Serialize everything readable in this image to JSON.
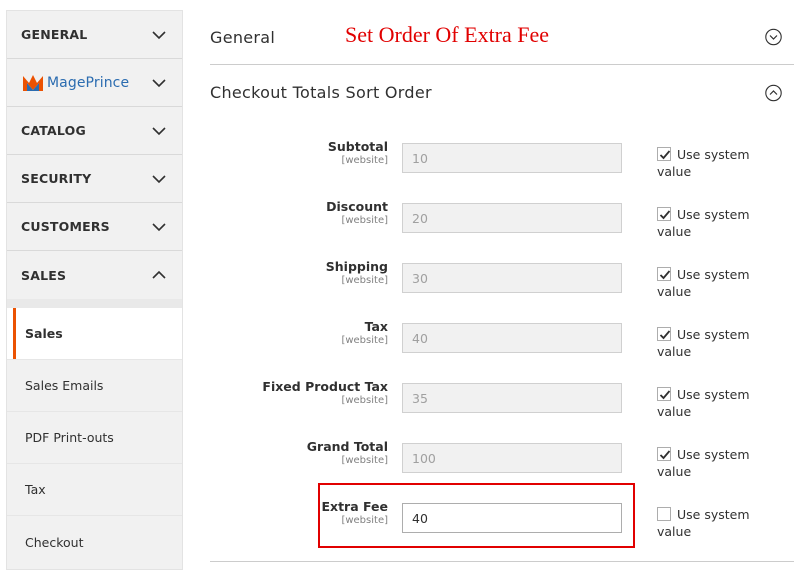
{
  "sidebar": {
    "sections": [
      {
        "label": "GENERAL",
        "icon": "chevron-down-icon"
      },
      {
        "brand": "MagePrince",
        "icon": "chevron-down-icon"
      },
      {
        "label": "CATALOG",
        "icon": "chevron-down-icon"
      },
      {
        "label": "SECURITY",
        "icon": "chevron-down-icon"
      },
      {
        "label": "CUSTOMERS",
        "icon": "chevron-down-icon"
      },
      {
        "label": "SALES",
        "icon": "chevron-up-icon"
      }
    ],
    "sales_items": [
      {
        "label": "Sales",
        "active": true
      },
      {
        "label": "Sales Emails"
      },
      {
        "label": "PDF Print-outs"
      },
      {
        "label": "Tax"
      },
      {
        "label": "Checkout"
      }
    ]
  },
  "main": {
    "general_title": "General",
    "annotation": "Set Order Of Extra Fee",
    "section_title": "Checkout Totals Sort Order",
    "rows": [
      {
        "label": "Subtotal",
        "scope": "[website]",
        "value": "10",
        "use_system": true
      },
      {
        "label": "Discount",
        "scope": "[website]",
        "value": "20",
        "use_system": true
      },
      {
        "label": "Shipping",
        "scope": "[website]",
        "value": "30",
        "use_system": true
      },
      {
        "label": "Tax",
        "scope": "[website]",
        "value": "40",
        "use_system": true
      },
      {
        "label": "Fixed Product Tax",
        "scope": "[website]",
        "value": "35",
        "use_system": true
      },
      {
        "label": "Grand Total",
        "scope": "[website]",
        "value": "100",
        "use_system": true
      },
      {
        "label": "Extra Fee",
        "scope": "[website]",
        "value": "40",
        "use_system": false
      }
    ],
    "use_system_label": "Use system value"
  },
  "colors": {
    "accent": "#eb5202",
    "annotation": "#e10000",
    "brand": "#2b6cb0"
  }
}
